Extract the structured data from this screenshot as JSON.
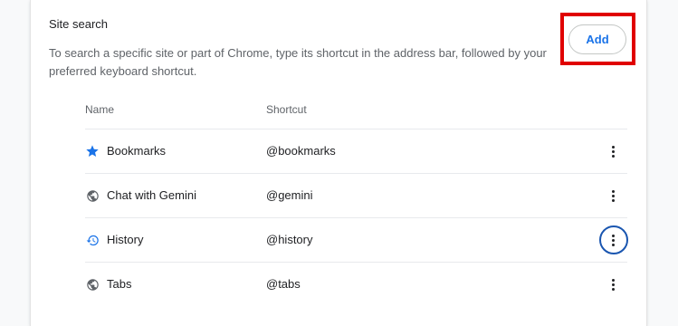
{
  "section": {
    "title": "Site search",
    "description": "To search a specific site or part of Chrome, type its shortcut in the address bar, followed by your preferred keyboard shortcut.",
    "add_label": "Add"
  },
  "table": {
    "headers": {
      "name": "Name",
      "shortcut": "Shortcut"
    },
    "rows": [
      {
        "name": "Bookmarks",
        "shortcut": "@bookmarks",
        "icon": "star-icon"
      },
      {
        "name": "Chat with Gemini",
        "shortcut": "@gemini",
        "icon": "globe-icon"
      },
      {
        "name": "History",
        "shortcut": "@history",
        "icon": "history-icon"
      },
      {
        "name": "Tabs",
        "shortcut": "@tabs",
        "icon": "globe-icon"
      }
    ]
  },
  "colors": {
    "accent": "#1a73e8",
    "highlight": "#e00000"
  }
}
